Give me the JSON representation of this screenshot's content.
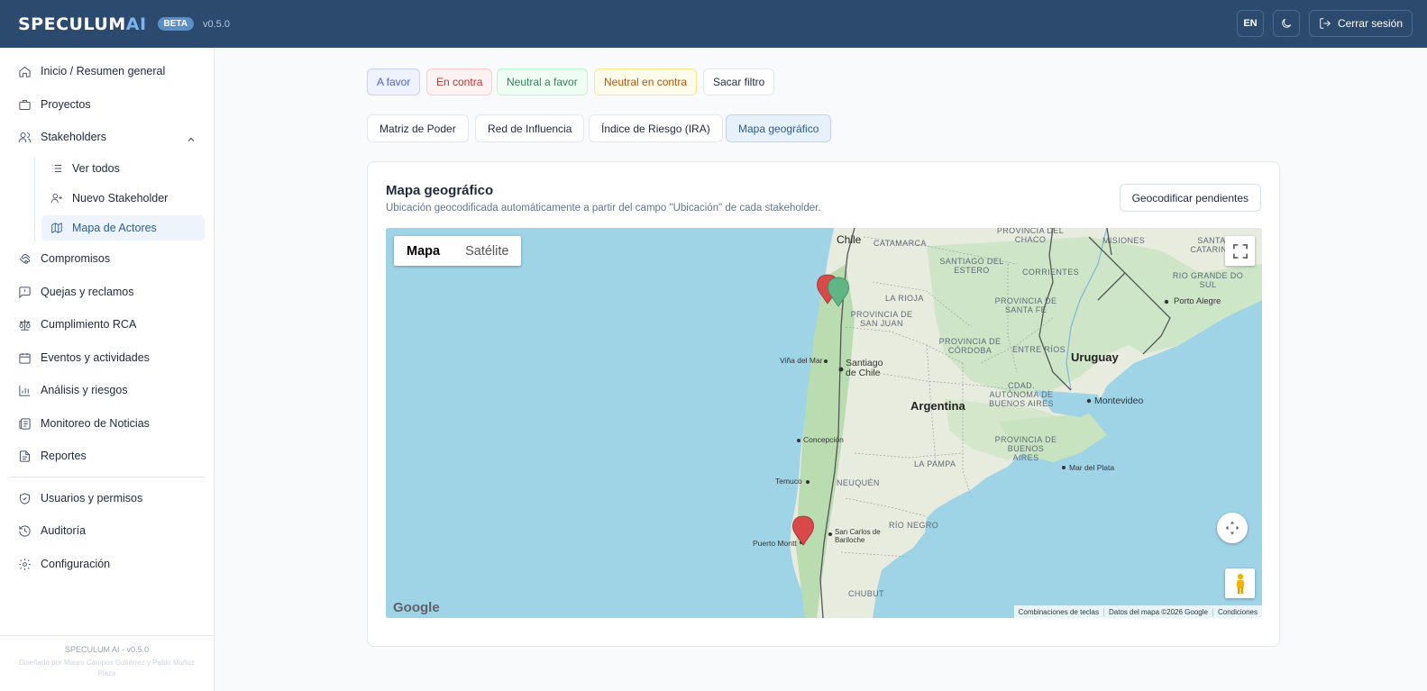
{
  "header": {
    "brand_main": "SPECULUM",
    "brand_ai": "AI",
    "badge": "BETA",
    "version": "v0.5.0",
    "lang_button": "EN",
    "logout_label": "Cerrar sesión"
  },
  "sidebar": {
    "items": [
      {
        "label": "Inicio / Resumen general",
        "icon": "home-icon"
      },
      {
        "label": "Proyectos",
        "icon": "briefcase-icon"
      },
      {
        "label": "Stakeholders",
        "icon": "users-icon"
      },
      {
        "label": "Compromisos",
        "icon": "handshake-icon"
      },
      {
        "label": "Quejas y reclamos",
        "icon": "message-alert-icon"
      },
      {
        "label": "Cumplimiento RCA",
        "icon": "scale-icon"
      },
      {
        "label": "Eventos y actividades",
        "icon": "calendar-icon"
      },
      {
        "label": "Análisis y riesgos",
        "icon": "bar-chart-icon"
      },
      {
        "label": "Monitoreo de Noticias",
        "icon": "newspaper-icon"
      },
      {
        "label": "Reportes",
        "icon": "file-icon"
      },
      {
        "label": "Usuarios y permisos",
        "icon": "shield-icon"
      },
      {
        "label": "Auditoría",
        "icon": "history-icon"
      },
      {
        "label": "Configuración",
        "icon": "gear-icon"
      }
    ],
    "subitems": [
      {
        "label": "Ver todos",
        "icon": "list-icon"
      },
      {
        "label": "Nuevo Stakeholder",
        "icon": "user-plus-icon"
      },
      {
        "label": "Mapa de Actores",
        "icon": "map-icon",
        "active": true
      }
    ],
    "footer_title": "SPECULUM AI · v0.5.0",
    "footer_credit": "Diseñado por Mauro Campos Gutiérrez y Pablo Muñoz Plaza"
  },
  "filters": [
    "A favor",
    "En contra",
    "Neutral a favor",
    "Neutral en contra",
    "Sacar filtro"
  ],
  "tabs": [
    {
      "label": "Matriz de Poder"
    },
    {
      "label": "Red de Influencia"
    },
    {
      "label": "Índice de Riesgo (IRA)"
    },
    {
      "label": "Mapa geográfico",
      "active": true
    }
  ],
  "card": {
    "title": "Mapa geográfico",
    "subtitle": "Ubicación geocodificada automáticamente a partir del campo \"Ubicación\" de cada stakeholder.",
    "geocode_button": "Geocodificar pendientes"
  },
  "map": {
    "type_map": "Mapa",
    "type_satellite": "Satélite",
    "logo": "Google",
    "attribution": [
      "Combinaciones de teclas",
      "Datos del mapa ©2026 Google",
      "Condiciones"
    ],
    "labels": {
      "chile": "Chile",
      "argentina": "Argentina",
      "uruguay": "Uruguay",
      "catamarca": "CATAMARCA",
      "chaco": "PROVINCIA DEL CHACO",
      "santiago_estero": "SANTIAGO DEL ESTERO",
      "misiones": "MISIONES",
      "santa_catarina": "SANTA CATARINA",
      "corrientes": "CORRIENTES",
      "rio_grande": "RIO GRANDE DO SUL",
      "la_rioja": "LA RIOJA",
      "santa_fe": "PROVINCIA DE SANTA FE",
      "san_juan": "PROVINCIA DE SAN JUAN",
      "cordoba": "PROVINCIA DE CÓRDOBA",
      "entre_rios": "ENTRE RÍOS",
      "porto_alegre": "Porto Alegre",
      "vina": "Viña del Mar",
      "santiago": "Santiago de Chile",
      "caba": "CDAD. AUTÓNOMA DE BUENOS AIRES",
      "montevideo": "Montevideo",
      "concepcion": "Concepción",
      "pba": "PROVINCIA DE BUENOS AIRES",
      "la_pampa": "LA PAMPA",
      "mar_plata": "Mar del Plata",
      "temuco": "Temuco",
      "neuquen": "NEUQUÉN",
      "rio_negro": "RÍO NEGRO",
      "bariloche": "San Carlos de Bariloche",
      "puerto_montt": "Puerto Montt",
      "chubut": "CHUBUT"
    },
    "markers": [
      {
        "color": "#d84a4a",
        "label": "red-marker"
      },
      {
        "color": "#5fb583",
        "label": "green-marker"
      },
      {
        "color": "#d84a4a",
        "label": "red-marker"
      }
    ]
  }
}
